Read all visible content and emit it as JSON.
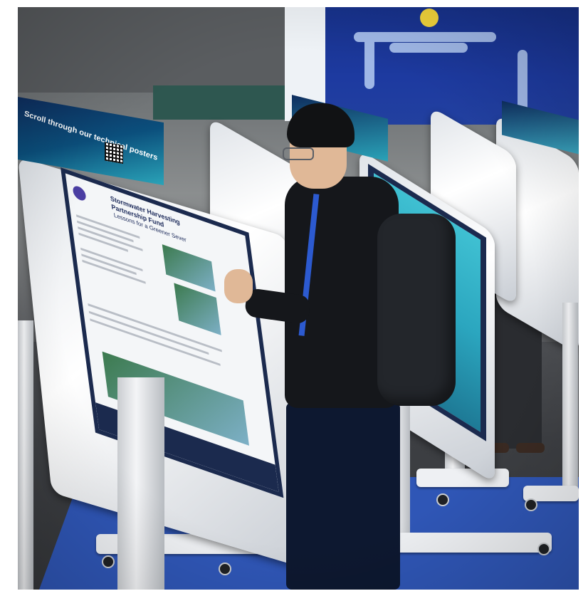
{
  "photo": {
    "alt_scene": "exhibition kiosks",
    "kiosk_header": "Scroll through our technical posters",
    "poster": {
      "title_line1": "Stormwater Harvesting",
      "title_line2": "Partnership Fund",
      "subtitle": "Lessons for a Greener Sever"
    },
    "colors": {
      "carpet": "#2f56b6",
      "kiosk_header": "#0b4f7c",
      "screen_blue": "#3fc0d2",
      "banner": "#1d3aa0"
    }
  }
}
